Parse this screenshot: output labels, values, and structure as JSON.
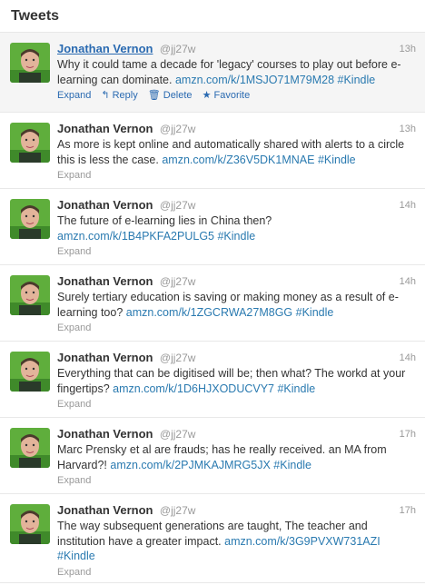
{
  "header": {
    "title": "Tweets"
  },
  "tweets": [
    {
      "fullname": "Jonathan Vernon",
      "username": "@jj27w",
      "time": "13h",
      "text": "Why it could tame a decade for 'legacy' courses to play out before e-learning can dominate.",
      "link": "amzn.com/k/1MSJO71M79M28",
      "hashtag": "#Kindle",
      "actions": {
        "expand": "Expand",
        "reply": "Reply",
        "delete": "Delete",
        "favorite": "Favorite"
      }
    },
    {
      "fullname": "Jonathan Vernon",
      "username": "@jj27w",
      "time": "13h",
      "text": "As more is kept online and automatically shared with alerts to a circle this is less the case.",
      "link": "amzn.com/k/Z36V5DK1MNAE",
      "hashtag": "#Kindle",
      "expand": "Expand"
    },
    {
      "fullname": "Jonathan Vernon",
      "username": "@jj27w",
      "time": "14h",
      "text": "The future of e-learning lies in China then?",
      "link": "amzn.com/k/1B4PKFA2PULG5",
      "hashtag": "#Kindle",
      "expand": "Expand"
    },
    {
      "fullname": "Jonathan Vernon",
      "username": "@jj27w",
      "time": "14h",
      "text": "Surely tertiary education is saving or making money as a result of e-learning too?",
      "link": "amzn.com/k/1ZGCRWA27M8GG",
      "hashtag": "#Kindle",
      "expand": "Expand"
    },
    {
      "fullname": "Jonathan Vernon",
      "username": "@jj27w",
      "time": "14h",
      "text": "Everything that can be digitised will be; then what? The workd at your fingertips?",
      "link": "amzn.com/k/1D6HJXODUCVY7",
      "hashtag": "#Kindle",
      "expand": "Expand"
    },
    {
      "fullname": "Jonathan Vernon",
      "username": "@jj27w",
      "time": "17h",
      "text": "Marc Prensky et al are frauds; has he really received. an MA from Harvard?!",
      "link": "amzn.com/k/2PJMKAJMRG5JX",
      "hashtag": "#Kindle",
      "expand": "Expand"
    },
    {
      "fullname": "Jonathan Vernon",
      "username": "@jj27w",
      "time": "17h",
      "text": "The way subsequent generations are taught, The teacher and institution have a greater impact.",
      "link": "amzn.com/k/3G9PVXW731AZI",
      "hashtag": "#Kindle",
      "expand": "Expand"
    }
  ]
}
